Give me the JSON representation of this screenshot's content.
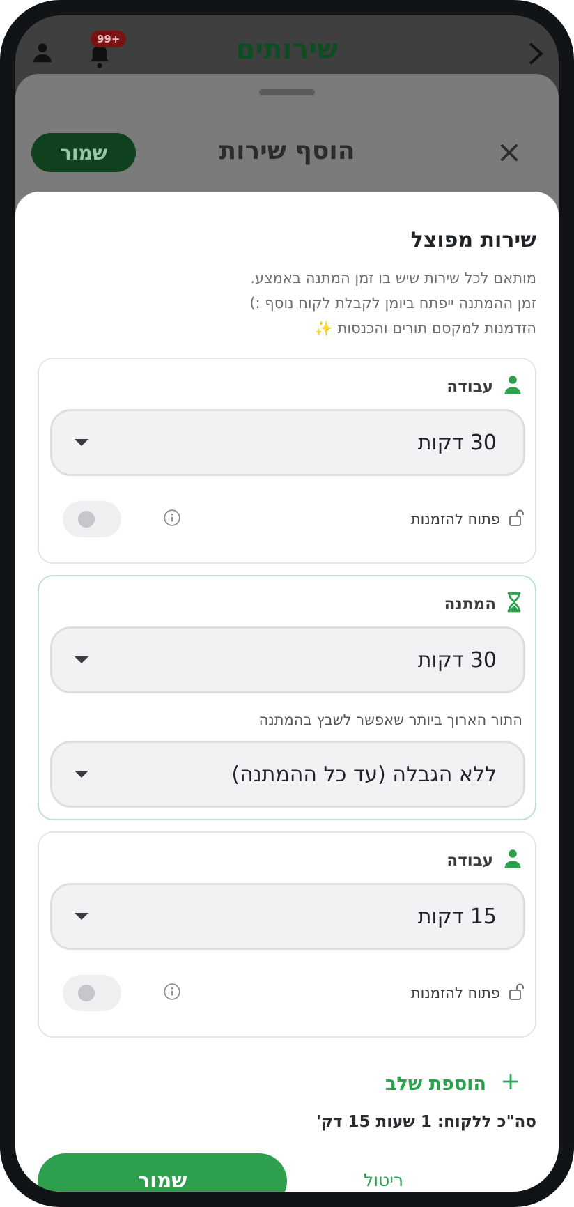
{
  "app_header": {
    "title": "שירותים",
    "notification_badge": "99+"
  },
  "back_sheet": {
    "title": "הוסף שירות",
    "save_label": "שמור"
  },
  "sheet": {
    "heading": "שירות מפוצל",
    "description_lines": [
      "מותאם לכל שירות שיש בו זמן המתנה באמצע.",
      "זמן ההמתנה ייפתח ביומן לקבלת לקוח נוסף :)",
      "הזדמנות למקסם תורים והכנסות ✨"
    ]
  },
  "steps": [
    {
      "type_label": "עבודה",
      "duration": "30 דקות",
      "open_label": "פתוח להזמנות",
      "open_enabled": false
    },
    {
      "type_label": "המתנה",
      "duration": "30 דקות",
      "limit_label": "התור הארוך ביותר שאפשר לשבץ בהמתנה",
      "limit_value": "ללא הגבלה (עד כל ההמתנה)"
    },
    {
      "type_label": "עבודה",
      "duration": "15 דקות",
      "open_label": "פתוח להזמנות",
      "open_enabled": false
    }
  ],
  "add_step_label": "הוספת שלב",
  "total_label": "סה\"כ ללקוח: 1 שעות 15 דק'",
  "footer": {
    "save_label": "שמור",
    "reset_label": "ריטול"
  },
  "colors": {
    "accent": "#2e9f4c",
    "wait_border": "#bfe4c9",
    "overlay": "#7b7b7b"
  },
  "icons": [
    "person-icon",
    "bell-icon",
    "chevron-right-icon",
    "close-icon",
    "hourglass-icon",
    "unlock-icon",
    "info-icon",
    "plus-icon"
  ]
}
